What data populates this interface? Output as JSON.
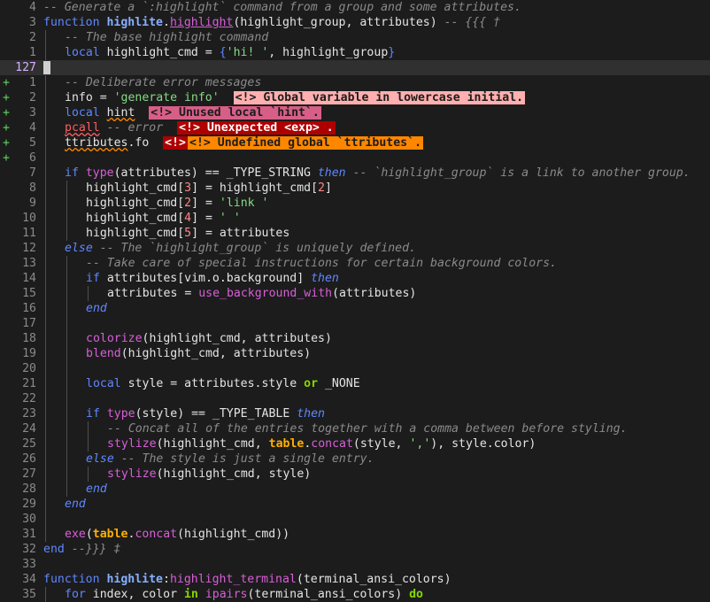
{
  "editor": {
    "current_line_number": "127",
    "lines": [
      {
        "n": "4",
        "sign": "",
        "indent": 0,
        "tokens": [
          {
            "c": "cm",
            "t": "-- Generate a `:highlight` command from a group and some attributes."
          }
        ]
      },
      {
        "n": "3",
        "sign": "",
        "indent": 0,
        "tokens": [
          {
            "c": "kw",
            "t": "function "
          },
          {
            "c": "fnb",
            "t": "highlite"
          },
          {
            "c": "",
            "t": "."
          },
          {
            "c": "fn ul",
            "t": "highlight"
          },
          {
            "c": "",
            "t": "(highlight_group, attributes) "
          },
          {
            "c": "cm",
            "t": "-- {{{ †"
          }
        ]
      },
      {
        "n": "2",
        "sign": "",
        "indent": 1,
        "tokens": [
          {
            "c": "cm",
            "t": "-- The base highlight command"
          }
        ]
      },
      {
        "n": "1",
        "sign": "",
        "indent": 1,
        "tokens": [
          {
            "c": "kw",
            "t": "local "
          },
          {
            "c": "",
            "t": "highlight_cmd = "
          },
          {
            "c": "br",
            "t": "{"
          },
          {
            "c": "str",
            "t": "'hi! '"
          },
          {
            "c": "",
            "t": ", highlight_group"
          },
          {
            "c": "br",
            "t": "}"
          }
        ]
      },
      {
        "n": "127",
        "sign": "",
        "indent": 0,
        "current": true,
        "tokens": []
      },
      {
        "n": "1",
        "sign": "+",
        "indent": 1,
        "tokens": [
          {
            "c": "cm",
            "t": "-- Deliberate error messages"
          }
        ]
      },
      {
        "n": "2",
        "sign": "+",
        "indent": 1,
        "tokens": [
          {
            "c": "",
            "t": "info = "
          },
          {
            "c": "str",
            "t": "'generate info'"
          },
          {
            "c": "",
            "t": "  "
          },
          {
            "c": "diag d-pink",
            "t": "<!> Global variable in lowercase initial."
          }
        ]
      },
      {
        "n": "3",
        "sign": "+",
        "indent": 1,
        "tokens": [
          {
            "c": "kw",
            "t": "local "
          },
          {
            "c": "und",
            "t": "hint"
          },
          {
            "c": "",
            "t": "  "
          },
          {
            "c": "diag d-mag",
            "t": "<!> Unused local `hint`."
          }
        ]
      },
      {
        "n": "4",
        "sign": "+",
        "indent": 1,
        "tokens": [
          {
            "c": "und-red",
            "t": "pcall"
          },
          {
            "c": "",
            "t": " "
          },
          {
            "c": "cm",
            "t": "-- error"
          },
          {
            "c": "",
            "t": "  "
          },
          {
            "c": "diag d-red",
            "t": "<!> Unexpected <exp> ."
          }
        ]
      },
      {
        "n": "5",
        "sign": "+",
        "indent": 1,
        "tokens": [
          {
            "c": "und",
            "t": "ttributes"
          },
          {
            "c": "",
            "t": ".fo  "
          },
          {
            "c": "diag d-red",
            "t": "<!>"
          },
          {
            "c": "diag d-orange",
            "t": "<!> Undefined global `ttributes`."
          }
        ]
      },
      {
        "n": "6",
        "sign": "+",
        "indent": 1,
        "tokens": []
      },
      {
        "n": "7",
        "sign": "",
        "indent": 1,
        "tokens": [
          {
            "c": "kw",
            "t": "if "
          },
          {
            "c": "fn",
            "t": "type"
          },
          {
            "c": "",
            "t": "(attributes) == _TYPE_STRING "
          },
          {
            "c": "kwi",
            "t": "then"
          },
          {
            "c": "",
            "t": " "
          },
          {
            "c": "cm",
            "t": "-- `highlight_group` is a link to another group."
          }
        ]
      },
      {
        "n": "8",
        "sign": "",
        "indent": 2,
        "tokens": [
          {
            "c": "",
            "t": "highlight_cmd["
          },
          {
            "c": "num-lit",
            "t": "3"
          },
          {
            "c": "",
            "t": "] = highlight_cmd["
          },
          {
            "c": "num-lit",
            "t": "2"
          },
          {
            "c": "",
            "t": "]"
          }
        ]
      },
      {
        "n": "9",
        "sign": "",
        "indent": 2,
        "tokens": [
          {
            "c": "",
            "t": "highlight_cmd["
          },
          {
            "c": "num-lit",
            "t": "2"
          },
          {
            "c": "",
            "t": "] = "
          },
          {
            "c": "str",
            "t": "'link '"
          }
        ]
      },
      {
        "n": "10",
        "sign": "",
        "indent": 2,
        "tokens": [
          {
            "c": "",
            "t": "highlight_cmd["
          },
          {
            "c": "num-lit",
            "t": "4"
          },
          {
            "c": "",
            "t": "] = "
          },
          {
            "c": "str",
            "t": "' '"
          }
        ]
      },
      {
        "n": "11",
        "sign": "",
        "indent": 2,
        "tokens": [
          {
            "c": "",
            "t": "highlight_cmd["
          },
          {
            "c": "num-lit",
            "t": "5"
          },
          {
            "c": "",
            "t": "] = attributes"
          }
        ]
      },
      {
        "n": "12",
        "sign": "",
        "indent": 1,
        "tokens": [
          {
            "c": "kwi",
            "t": "else"
          },
          {
            "c": "",
            "t": " "
          },
          {
            "c": "cm",
            "t": "-- The `highlight_group` is uniquely defined."
          }
        ]
      },
      {
        "n": "13",
        "sign": "",
        "indent": 2,
        "tokens": [
          {
            "c": "cm",
            "t": "-- Take care of special instructions for certain background colors."
          }
        ]
      },
      {
        "n": "14",
        "sign": "",
        "indent": 2,
        "tokens": [
          {
            "c": "kw",
            "t": "if "
          },
          {
            "c": "",
            "t": "attributes[vim.o.background] "
          },
          {
            "c": "kwi",
            "t": "then"
          }
        ]
      },
      {
        "n": "15",
        "sign": "",
        "indent": 3,
        "tokens": [
          {
            "c": "",
            "t": "attributes = "
          },
          {
            "c": "fn",
            "t": "use_background_with"
          },
          {
            "c": "",
            "t": "(attributes)"
          }
        ]
      },
      {
        "n": "16",
        "sign": "",
        "indent": 2,
        "tokens": [
          {
            "c": "kwi",
            "t": "end"
          }
        ]
      },
      {
        "n": "17",
        "sign": "",
        "indent": 2,
        "tokens": []
      },
      {
        "n": "18",
        "sign": "",
        "indent": 2,
        "tokens": [
          {
            "c": "fn",
            "t": "colorize"
          },
          {
            "c": "",
            "t": "(highlight_cmd, attributes)"
          }
        ]
      },
      {
        "n": "19",
        "sign": "",
        "indent": 2,
        "tokens": [
          {
            "c": "fn",
            "t": "blend"
          },
          {
            "c": "",
            "t": "(highlight_cmd, attributes)"
          }
        ]
      },
      {
        "n": "20",
        "sign": "",
        "indent": 2,
        "tokens": []
      },
      {
        "n": "21",
        "sign": "",
        "indent": 2,
        "tokens": [
          {
            "c": "kw",
            "t": "local "
          },
          {
            "c": "",
            "t": "style = attributes.style "
          },
          {
            "c": "kwb",
            "t": "or"
          },
          {
            "c": "",
            "t": " _NONE"
          }
        ]
      },
      {
        "n": "22",
        "sign": "",
        "indent": 2,
        "tokens": []
      },
      {
        "n": "23",
        "sign": "",
        "indent": 2,
        "tokens": [
          {
            "c": "kw",
            "t": "if "
          },
          {
            "c": "fn",
            "t": "type"
          },
          {
            "c": "",
            "t": "(style) == _TYPE_TABLE "
          },
          {
            "c": "kwi",
            "t": "then"
          }
        ]
      },
      {
        "n": "24",
        "sign": "",
        "indent": 3,
        "tokens": [
          {
            "c": "cm",
            "t": "-- Concat all of the entries together with a comma between before styling."
          }
        ]
      },
      {
        "n": "25",
        "sign": "",
        "indent": 3,
        "tokens": [
          {
            "c": "fn",
            "t": "stylize"
          },
          {
            "c": "",
            "t": "(highlight_cmd, "
          },
          {
            "c": "lib",
            "t": "table"
          },
          {
            "c": "",
            "t": "."
          },
          {
            "c": "fn",
            "t": "concat"
          },
          {
            "c": "",
            "t": "(style, "
          },
          {
            "c": "str",
            "t": "','"
          },
          {
            "c": "",
            "t": "), style.color)"
          }
        ]
      },
      {
        "n": "26",
        "sign": "",
        "indent": 2,
        "tokens": [
          {
            "c": "kwi",
            "t": "else"
          },
          {
            "c": "",
            "t": " "
          },
          {
            "c": "cm",
            "t": "-- The style is just a single entry."
          }
        ]
      },
      {
        "n": "27",
        "sign": "",
        "indent": 3,
        "tokens": [
          {
            "c": "fn",
            "t": "stylize"
          },
          {
            "c": "",
            "t": "(highlight_cmd, style)"
          }
        ]
      },
      {
        "n": "28",
        "sign": "",
        "indent": 2,
        "tokens": [
          {
            "c": "kwi",
            "t": "end"
          }
        ]
      },
      {
        "n": "29",
        "sign": "",
        "indent": 1,
        "tokens": [
          {
            "c": "kwi",
            "t": "end"
          }
        ]
      },
      {
        "n": "30",
        "sign": "",
        "indent": 1,
        "tokens": []
      },
      {
        "n": "31",
        "sign": "",
        "indent": 1,
        "tokens": [
          {
            "c": "fn",
            "t": "exe"
          },
          {
            "c": "",
            "t": "("
          },
          {
            "c": "lib",
            "t": "table"
          },
          {
            "c": "",
            "t": "."
          },
          {
            "c": "fn",
            "t": "concat"
          },
          {
            "c": "",
            "t": "(highlight_cmd))"
          }
        ]
      },
      {
        "n": "32",
        "sign": "",
        "indent": 0,
        "tokens": [
          {
            "c": "kw",
            "t": "end"
          },
          {
            "c": "",
            "t": " "
          },
          {
            "c": "cm",
            "t": "--}}} ‡"
          }
        ]
      },
      {
        "n": "33",
        "sign": "",
        "indent": 0,
        "tokens": []
      },
      {
        "n": "34",
        "sign": "",
        "indent": 0,
        "tokens": [
          {
            "c": "kw",
            "t": "function "
          },
          {
            "c": "fnb",
            "t": "highlite"
          },
          {
            "c": "",
            "t": ":"
          },
          {
            "c": "fn",
            "t": "highlight_terminal"
          },
          {
            "c": "",
            "t": "(terminal_ansi_colors)"
          }
        ]
      },
      {
        "n": "35",
        "sign": "",
        "indent": 1,
        "tokens": [
          {
            "c": "kw",
            "t": "for "
          },
          {
            "c": "",
            "t": "index, color "
          },
          {
            "c": "kwb",
            "t": "in"
          },
          {
            "c": "",
            "t": " "
          },
          {
            "c": "fn",
            "t": "ipairs"
          },
          {
            "c": "",
            "t": "(terminal_ansi_colors) "
          },
          {
            "c": "kwb",
            "t": "do"
          }
        ]
      }
    ]
  }
}
